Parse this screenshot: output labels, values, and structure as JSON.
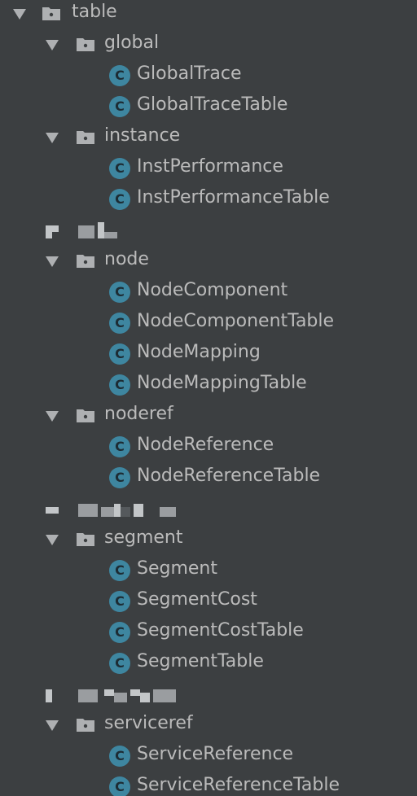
{
  "tree": {
    "root": {
      "label": "table"
    },
    "global": {
      "label": "global",
      "classes": [
        "GlobalTrace",
        "GlobalTraceTable"
      ]
    },
    "instance": {
      "label": "instance",
      "classes": [
        "InstPerformance",
        "InstPerformanceTable"
      ]
    },
    "node": {
      "label": "node",
      "classes": [
        "NodeComponent",
        "NodeComponentTable",
        "NodeMapping",
        "NodeMappingTable"
      ]
    },
    "noderef": {
      "label": "noderef",
      "classes": [
        "NodeReference",
        "NodeReferenceTable"
      ]
    },
    "segment": {
      "label": "segment",
      "classes": [
        "Segment",
        "SegmentCost",
        "SegmentCostTable",
        "SegmentTable"
      ]
    },
    "serviceref": {
      "label": "serviceref",
      "classes": [
        "ServiceReference",
        "ServiceReferenceTable"
      ]
    },
    "icon_letter": "C"
  },
  "colors": {
    "background": "#3c3f41",
    "text": "#bbbbbb",
    "class_icon": "#3e86a0",
    "folder": "#aeb0b2"
  }
}
